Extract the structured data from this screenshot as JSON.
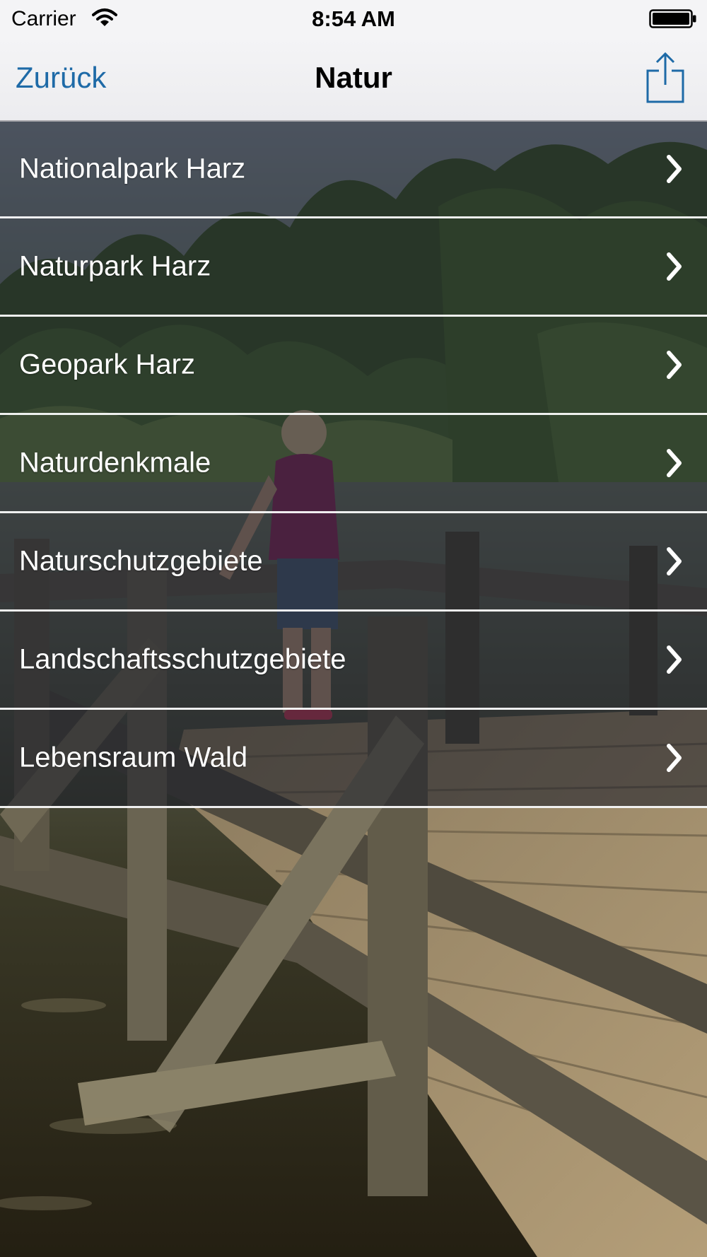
{
  "status_bar": {
    "carrier": "Carrier",
    "time": "8:54 AM",
    "wifi_icon": "wifi-icon",
    "battery_icon": "battery-icon"
  },
  "nav_bar": {
    "back_label": "Zurück",
    "title": "Natur",
    "share_icon": "share-icon",
    "accent_color": "#1e6aa7"
  },
  "menu": {
    "items": [
      {
        "label": "Nationalpark Harz",
        "icon": "chevron-right-icon"
      },
      {
        "label": "Naturpark Harz",
        "icon": "chevron-right-icon"
      },
      {
        "label": "Geopark Harz",
        "icon": "chevron-right-icon"
      },
      {
        "label": "Naturdenkmale",
        "icon": "chevron-right-icon"
      },
      {
        "label": "Naturschutzgebiete",
        "icon": "chevron-right-icon"
      },
      {
        "label": "Landschaftsschutzgebiete",
        "icon": "chevron-right-icon"
      },
      {
        "label": "Lebensraum Wald",
        "icon": "chevron-right-icon"
      }
    ]
  }
}
